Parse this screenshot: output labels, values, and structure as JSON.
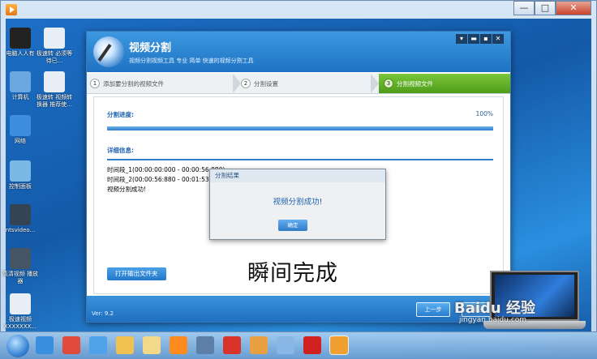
{
  "desktop": {
    "icons": [
      {
        "label": "电脑人人有",
        "color": "#222222"
      },
      {
        "label": "极速转 必须等待已...",
        "color": "#e8eef5"
      },
      {
        "label": "计算机",
        "color": "#6aa7e0"
      },
      {
        "label": "极速转 视频转换器 推荐使...",
        "color": "#e8eef5"
      },
      {
        "label": "网络",
        "color": "#3d8ee0"
      },
      {
        "label": "控制面板",
        "color": "#7ab8e8"
      },
      {
        "label": "ntsvideo...",
        "color": "#334455"
      },
      {
        "label": "高清视频 播放器",
        "color": "#445566"
      },
      {
        "label": "极速视频 XXXXXXX...",
        "color": "#e8eef5"
      }
    ]
  },
  "outer_window": {
    "min": "—",
    "max": "□",
    "close": "✕"
  },
  "app": {
    "title": "视频分割",
    "subtitle": "视频分割视频工具 专业 简单 快速的视频分割工具",
    "ctrl_menu": "▾",
    "ctrl_min": "▬",
    "ctrl_max": "▪",
    "ctrl_close": "✕",
    "steps": [
      {
        "num": "1",
        "label": "添加要分割的视频文件"
      },
      {
        "num": "2",
        "label": "分割设置"
      },
      {
        "num": "3",
        "label": "分割视频文件"
      }
    ],
    "progress_label": "分割进度:",
    "progress_value": "100%",
    "progress_fraction": 1.0,
    "details_label": "详细信息:",
    "log": [
      "时间段_1(00:00:00:000 - 00:00:56:880)",
      "时间段_2(00:00:56:880 - 00:01:53:...)",
      "视频分割成功!"
    ],
    "open_folder": "打开输出文件夹",
    "version": "Ver: 9.2",
    "prev_button": "上一步",
    "back_button": "返回"
  },
  "dialog": {
    "title": "分割结果",
    "message": "视频分割成功!",
    "ok": "确定"
  },
  "caption": "瞬间完成",
  "taskbar": {
    "items": [
      {
        "name": "ie",
        "color": "#3a8fe0"
      },
      {
        "name": "chrome",
        "color": "#e24a3b"
      },
      {
        "name": "cloud",
        "color": "#4fa3e8"
      },
      {
        "name": "folder",
        "color": "#f0c050"
      },
      {
        "name": "explorer",
        "color": "#f2d98a"
      },
      {
        "name": "media",
        "color": "#ff8a1e"
      },
      {
        "name": "screen",
        "color": "#5b7fa6"
      },
      {
        "name": "wps",
        "color": "#d9342b"
      },
      {
        "name": "tool",
        "color": "#e8a040"
      },
      {
        "name": "network",
        "color": "#88b7e6"
      },
      {
        "name": "game",
        "color": "#d12020"
      },
      {
        "name": "video-split",
        "color": "#f0a030"
      }
    ]
  },
  "watermark": {
    "line1": "Baidu 经验",
    "line2": "jingyan.baidu.com"
  }
}
